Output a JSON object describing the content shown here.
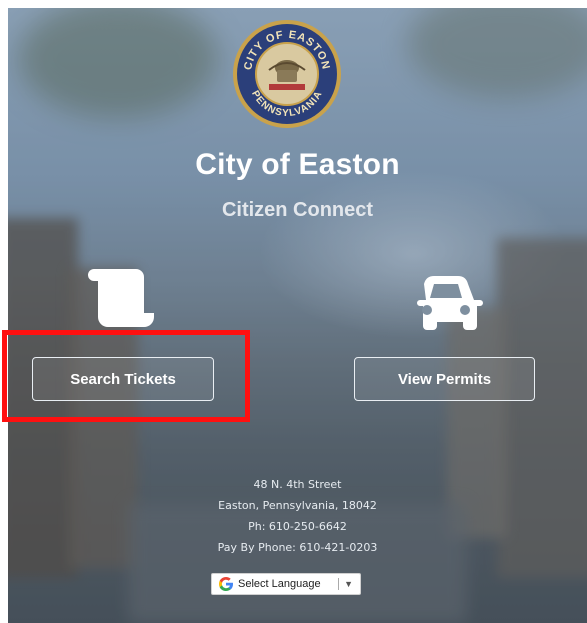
{
  "header": {
    "title": "City of Easton",
    "subtitle": "Citizen Connect",
    "seal_text_top": "CITY OF EASTON",
    "seal_text_bottom": "PENNSYLVANIA"
  },
  "actions": {
    "search_tickets": {
      "label": "Search Tickets",
      "icon": "scroll-icon"
    },
    "view_permits": {
      "label": "View Permits",
      "icon": "car-icon"
    }
  },
  "contact": {
    "address_line1": "48 N. 4th Street",
    "address_line2": "Easton, Pennsylvania, 18042",
    "phone": "Ph: 610-250-6642",
    "pay_by_phone": "Pay By Phone: 610-421-0203"
  },
  "language_selector": {
    "label": "Select Language",
    "icon": "google-g-icon",
    "arrow": "▼"
  },
  "colors": {
    "highlight": "#ff1010",
    "text": "#ffffff",
    "seal_ring": "#2b3f7a",
    "seal_gold": "#c9a24b"
  }
}
